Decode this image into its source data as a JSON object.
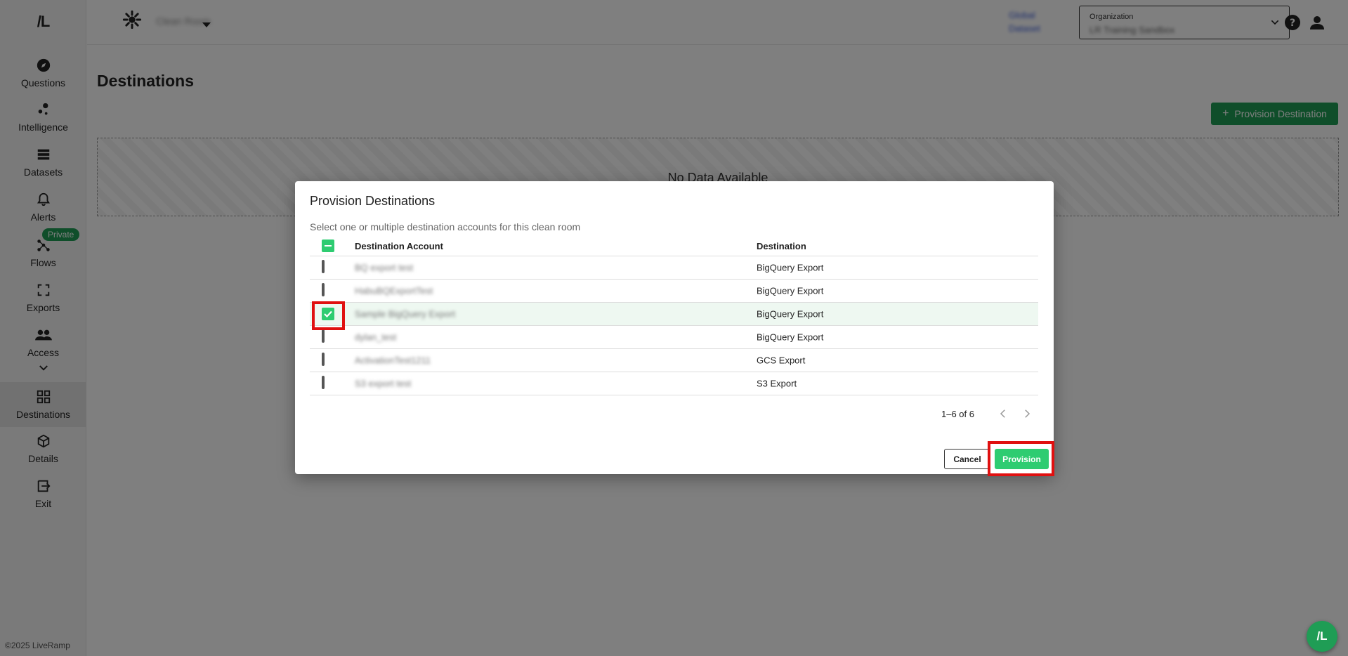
{
  "app": {
    "logo_text": "/L",
    "copyright": "©2025 LiveRamp"
  },
  "sidebar": {
    "items": [
      {
        "label": "Questions",
        "icon": "compass-icon"
      },
      {
        "label": "Intelligence",
        "icon": "nodes-icon"
      },
      {
        "label": "Datasets",
        "icon": "stack-icon"
      },
      {
        "label": "Alerts",
        "icon": "bell-icon"
      },
      {
        "label": "Flows",
        "icon": "flow-icon",
        "badge": "Private"
      },
      {
        "label": "Exports",
        "icon": "frame-icon"
      },
      {
        "label": "Access",
        "icon": "people-icon"
      },
      {
        "label": "Destinations",
        "icon": "grid-icon",
        "active": true
      },
      {
        "label": "Details",
        "icon": "cube-icon"
      },
      {
        "label": "Exit",
        "icon": "exit-icon"
      }
    ]
  },
  "header": {
    "user_name": "Clean Room",
    "link_text_line1": "Global",
    "link_text_line2": "Dataset",
    "org_label": "Organization",
    "org_value": "LR Training Sandbox"
  },
  "page": {
    "title": "Destinations",
    "provision_destination_label": "Provision Destination",
    "empty_text": "No Data Available"
  },
  "dialog": {
    "title": "Provision Destinations",
    "subtitle": "Select one or multiple destination accounts for this clean room",
    "columns": {
      "account": "Destination Account",
      "destination": "Destination"
    },
    "rows": [
      {
        "account": "BQ export test",
        "destination": "BigQuery Export",
        "checked": false
      },
      {
        "account": "HabuBQExportTest",
        "destination": "BigQuery Export",
        "checked": false
      },
      {
        "account": "Sample BigQuery Export",
        "destination": "BigQuery Export",
        "checked": true
      },
      {
        "account": "dylan_test",
        "destination": "BigQuery Export",
        "checked": false
      },
      {
        "account": "ActivationTest1211",
        "destination": "GCS Export",
        "checked": false
      },
      {
        "account": "S3 export test",
        "destination": "S3 Export",
        "checked": false
      }
    ],
    "pagination": "1–6 of 6",
    "cancel_label": "Cancel",
    "provision_label": "Provision"
  },
  "colors": {
    "brand_green": "#1f9d55",
    "accent_green": "#2ecc71",
    "highlight_red": "#e01010"
  }
}
